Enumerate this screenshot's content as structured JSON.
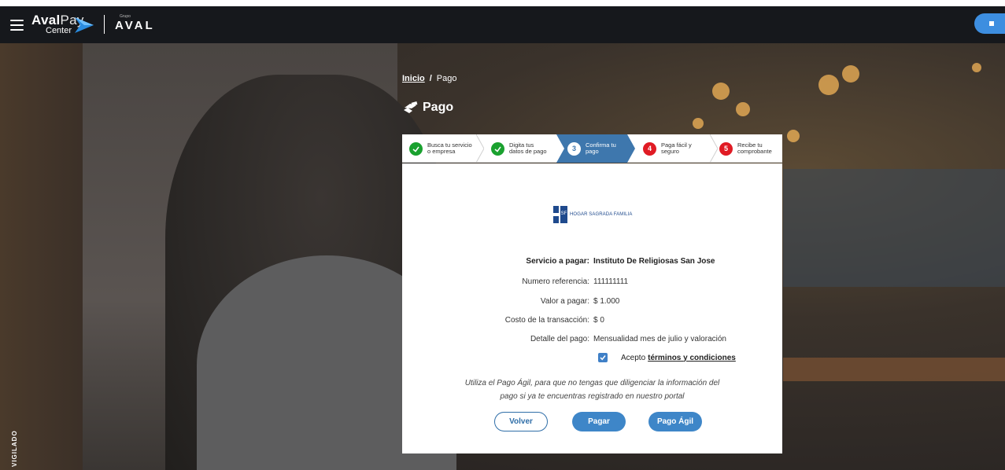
{
  "header": {
    "brand_main": "Aval",
    "brand_light": "Pay",
    "brand_sub": "Center",
    "group_small": "Grupo",
    "group_big": "AVAL"
  },
  "side_badge": "VIGILADO",
  "breadcrumb": {
    "home": "Inicio",
    "separator": "/",
    "current": "Pago"
  },
  "title": "Pago",
  "steps": [
    {
      "num": "",
      "label_1": "Busca tu servicio",
      "label_2": "o empresa",
      "state": "done"
    },
    {
      "num": "",
      "label_1": "Digita tus",
      "label_2": "datos de pago",
      "state": "done"
    },
    {
      "num": "3",
      "label_1": "Confirma tu",
      "label_2": "pago",
      "state": "active"
    },
    {
      "num": "4",
      "label_1": "Paga fácil y",
      "label_2": "seguro",
      "state": "todo"
    },
    {
      "num": "5",
      "label_1": "Recibe tu",
      "label_2": "comprobante",
      "state": "todo"
    }
  ],
  "merchant": {
    "logo_text": "SF",
    "name": "HOGAR SAGRADA FAMILIA"
  },
  "details": {
    "service": {
      "label": "Servicio a pagar:",
      "value": "Instituto De Religiosas San Jose"
    },
    "reference": {
      "label": "Numero referencia:",
      "value": "111111111"
    },
    "amount": {
      "label": "Valor a pagar:",
      "value": "$ 1.000"
    },
    "cost": {
      "label": "Costo de la transacción:",
      "value": "$ 0"
    },
    "detail": {
      "label": "Detalle del pago:",
      "value": "Mensualidad mes de julio y valoración"
    }
  },
  "terms": {
    "prefix": "Acepto",
    "link": "términos y condiciones",
    "checked": true
  },
  "hint": "Utiliza el Pago Ágil, para que no tengas que diligenciar la información del pago si ya te encuentras registrado en nuestro portal",
  "buttons": {
    "back": "Volver",
    "pay": "Pagar",
    "quick_pay": "Pago Ágil"
  },
  "colors": {
    "accent": "#3e86c8",
    "done": "#1aa12f",
    "pending": "#e01b24",
    "active_step": "#3e77ad"
  }
}
